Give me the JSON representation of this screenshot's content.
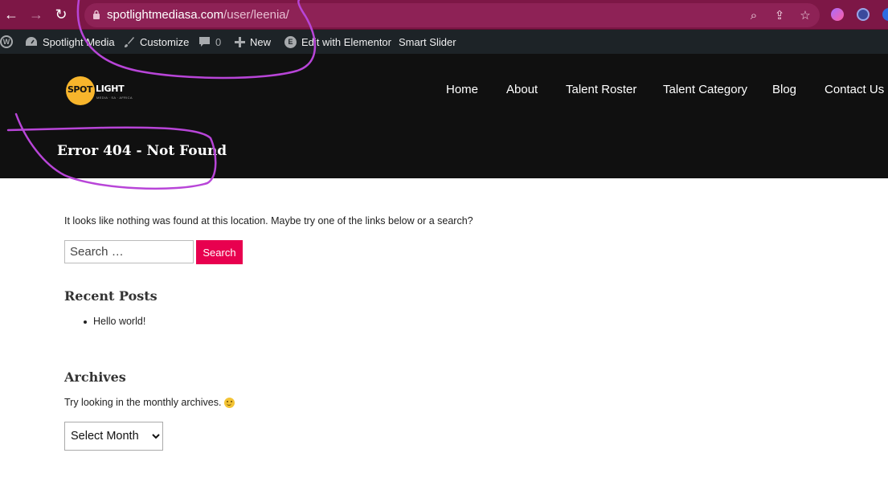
{
  "browser": {
    "url_domain": "spotlightmediasa.com",
    "url_path": "/user/leenia/",
    "back_glyph": "←",
    "forward_glyph": "→",
    "reload_glyph": "↻",
    "zoom_glyph": "⌕",
    "share_glyph": "⇪",
    "star_glyph": "☆",
    "icons": [
      "back-arrow-icon",
      "forward-arrow-icon",
      "reload-icon",
      "lock-icon",
      "zoom-icon",
      "share-icon",
      "star-icon",
      "extension-icon",
      "wordpress-extension-icon"
    ]
  },
  "admin_bar": {
    "wp_logo_glyph": "W",
    "site_name": "Spotlight Media",
    "customize": "Customize",
    "comments_count": "0",
    "new": "New",
    "elementor": "Edit with Elementor",
    "elementor_glyph": "E",
    "smart_slider": "Smart Slider"
  },
  "logo": {
    "spot": "SPOT",
    "light": "LIGHT",
    "sub": "MEDIA · SA · AFRICA"
  },
  "nav": {
    "home": "Home",
    "about": "About",
    "talent_roster": "Talent Roster",
    "talent_category": "Talent Category",
    "blog": "Blog",
    "contact": "Contact Us"
  },
  "page": {
    "title": "Error 404 - Not Found",
    "intro": "It looks like nothing was found at this location. Maybe try one of the links below or a search?"
  },
  "search": {
    "placeholder": "Search …",
    "button": "Search"
  },
  "recent_posts": {
    "title": "Recent Posts",
    "items": [
      "Hello world!"
    ]
  },
  "archives": {
    "title": "Archives",
    "text": "Try looking in the monthly archives.",
    "select_value": "Select Month"
  },
  "colors": {
    "browser_bar": "#7d1746",
    "accent": "#e8004f",
    "annotation": "#b845d8",
    "logo_yellow": "#f7b52c"
  }
}
